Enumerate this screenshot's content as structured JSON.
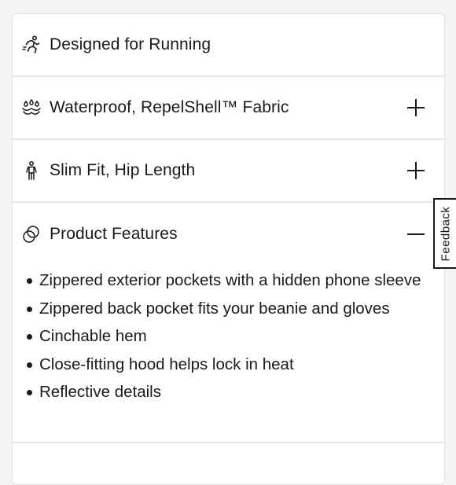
{
  "accordion": {
    "items": [
      {
        "icon": "running-person-icon",
        "label": "Designed for Running",
        "state": "none"
      },
      {
        "icon": "water-drops-icon",
        "label": "Waterproof, RepelShell™ Fabric",
        "state": "collapsed"
      },
      {
        "icon": "person-fit-icon",
        "label": "Slim Fit, Hip Length",
        "state": "collapsed"
      },
      {
        "icon": "features-circles-icon",
        "label": "Product Features",
        "state": "expanded"
      }
    ],
    "features": [
      "Zippered exterior pockets with a hidden phone sleeve",
      "Zippered back pocket fits your beanie and gloves",
      "Cinchable hem",
      "Close-fitting hood helps lock in heat",
      "Reflective details"
    ]
  },
  "feedback": {
    "label": "Feedback"
  },
  "colors": {
    "text": "#1a1a1a",
    "divider": "#e6e6e6",
    "background": "#ffffff"
  }
}
